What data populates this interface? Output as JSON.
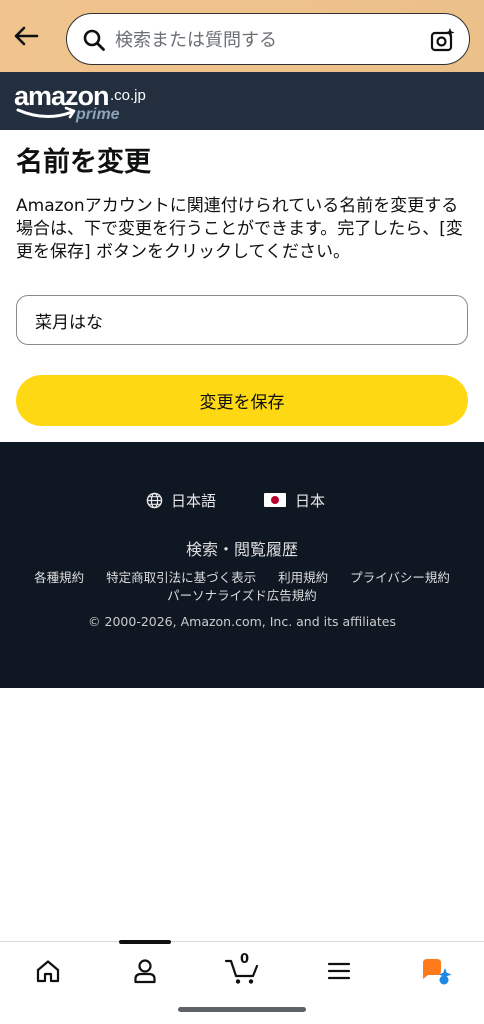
{
  "header": {
    "search_placeholder": "検索または質問する"
  },
  "brand": {
    "logo_main": "amazon",
    "logo_domain": ".co.jp",
    "logo_sub": "prime"
  },
  "main": {
    "title": "名前を変更",
    "description": "Amazonアカウントに関連付けられている名前を変更する場合は、下で変更を行うことができます。完了したら、[変更を保存] ボタンをクリックしてください。",
    "name_value": "菜月はな",
    "save_label": "変更を保存"
  },
  "footer": {
    "language": "日本語",
    "region": "日本",
    "history": "検索・閲覧履歴",
    "links_row1": [
      "各種規約",
      "特定商取引法に基づく表示",
      "利用規約",
      "プライバシー規約"
    ],
    "links_row2": [
      "パーソナライズド広告規約"
    ],
    "copyright": "© 2000-2026, Amazon.com, Inc. and its affiliates"
  },
  "bottom_nav": {
    "cart_count": "0",
    "items": [
      {
        "icon": "home-icon"
      },
      {
        "icon": "account-icon"
      },
      {
        "icon": "cart-icon"
      },
      {
        "icon": "menu-icon"
      },
      {
        "icon": "ai-assistant-icon"
      }
    ]
  },
  "colors": {
    "header_bg": "#f1c48e",
    "brand_bar_bg": "#232f3e",
    "save_button": "#ffd814",
    "footer_bg": "#0f1722",
    "ai_orange": "#ff7a1a",
    "ai_blue": "#1e88e5"
  }
}
